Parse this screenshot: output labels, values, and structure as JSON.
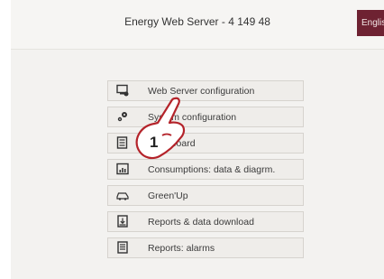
{
  "header": {
    "title": "Energy Web Server - 4 149 48",
    "language_button": "English"
  },
  "menu": {
    "items": [
      {
        "label": "Web Server configuration",
        "icon": "monitor-settings-icon"
      },
      {
        "label": "System configuration",
        "icon": "gears-icon"
      },
      {
        "label": "Main board",
        "icon": "dashboard-icon"
      },
      {
        "label": "Consumptions: data & diagrm.",
        "icon": "chart-icon"
      },
      {
        "label": "Green'Up",
        "icon": "car-icon"
      },
      {
        "label": "Reports & data download",
        "icon": "report-download-icon"
      },
      {
        "label": "Reports: alarms",
        "icon": "alarm-report-icon"
      }
    ]
  },
  "overlay": {
    "step_number": "1",
    "icon": "pointing-hand-icon"
  }
}
